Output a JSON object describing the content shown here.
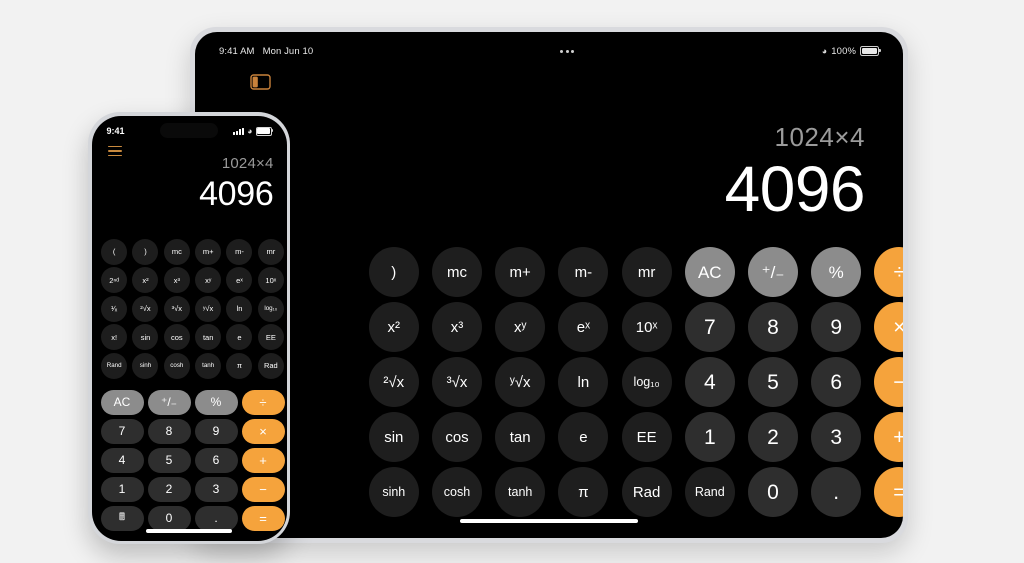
{
  "background_color": "#f2f2f2",
  "accent_color": "#f5a33c",
  "ipad": {
    "device_name": "iPad",
    "status_bar": {
      "time": "9:41 AM",
      "date": "Mon Jun 10",
      "multitask_icon": "ellipsis-icon",
      "wifi_icon": "wifi-icon",
      "battery_percent": "100%",
      "battery_icon": "battery-full-icon"
    },
    "sidebar_toggle_icon": "sidebar-toggle-icon",
    "display": {
      "expression": "1024×4",
      "result": "4096"
    },
    "home_indicator": "home-indicator",
    "keypad": {
      "columns": 10,
      "rows": [
        [
          {
            "label": ")",
            "style": "fn",
            "name": "close-paren"
          },
          {
            "label": "mc",
            "style": "fn",
            "name": "memory-clear"
          },
          {
            "label": "m+",
            "style": "fn",
            "name": "memory-add"
          },
          {
            "label": "m-",
            "style": "fn",
            "name": "memory-subtract"
          },
          {
            "label": "mr",
            "style": "fn",
            "name": "memory-recall"
          },
          {
            "label": "AC",
            "style": "light",
            "name": "all-clear"
          },
          {
            "label": "⁺/₋",
            "style": "light",
            "name": "plus-minus"
          },
          {
            "label": "%",
            "style": "light",
            "name": "percent"
          },
          {
            "label": "÷",
            "style": "accent",
            "name": "divide"
          }
        ],
        [
          {
            "label": "x²",
            "style": "fn",
            "name": "x-squared"
          },
          {
            "label": "x³",
            "style": "fn",
            "name": "x-cubed"
          },
          {
            "label": "xʸ",
            "style": "fn",
            "name": "x-power-y"
          },
          {
            "label": "eˣ",
            "style": "fn",
            "name": "e-power-x"
          },
          {
            "label": "10ˣ",
            "style": "fn",
            "name": "ten-power-x"
          },
          {
            "label": "7",
            "style": "num",
            "name": "digit-7"
          },
          {
            "label": "8",
            "style": "num",
            "name": "digit-8"
          },
          {
            "label": "9",
            "style": "num",
            "name": "digit-9"
          },
          {
            "label": "×",
            "style": "accent",
            "name": "multiply"
          }
        ],
        [
          {
            "label": "²√x",
            "style": "fn",
            "name": "square-root"
          },
          {
            "label": "³√x",
            "style": "fn",
            "name": "cube-root"
          },
          {
            "label": "ʸ√x",
            "style": "fn",
            "name": "y-root"
          },
          {
            "label": "ln",
            "style": "fn",
            "name": "natural-log"
          },
          {
            "label": "log₁₀",
            "style": "fn",
            "name": "log-base-10"
          },
          {
            "label": "4",
            "style": "num",
            "name": "digit-4"
          },
          {
            "label": "5",
            "style": "num",
            "name": "digit-5"
          },
          {
            "label": "6",
            "style": "num",
            "name": "digit-6"
          },
          {
            "label": "−",
            "style": "accent",
            "name": "subtract"
          }
        ],
        [
          {
            "label": "sin",
            "style": "fn",
            "name": "sine"
          },
          {
            "label": "cos",
            "style": "fn",
            "name": "cosine"
          },
          {
            "label": "tan",
            "style": "fn",
            "name": "tangent"
          },
          {
            "label": "e",
            "style": "fn",
            "name": "euler-number"
          },
          {
            "label": "EE",
            "style": "fn",
            "name": "exponent-entry"
          },
          {
            "label": "1",
            "style": "num",
            "name": "digit-1"
          },
          {
            "label": "2",
            "style": "num",
            "name": "digit-2"
          },
          {
            "label": "3",
            "style": "num",
            "name": "digit-3"
          },
          {
            "label": "+",
            "style": "accent",
            "name": "add"
          }
        ],
        [
          {
            "label": "sinh",
            "style": "fn",
            "name": "hyperbolic-sine"
          },
          {
            "label": "cosh",
            "style": "fn",
            "name": "hyperbolic-cosine"
          },
          {
            "label": "tanh",
            "style": "fn",
            "name": "hyperbolic-tangent"
          },
          {
            "label": "π",
            "style": "fn",
            "name": "pi"
          },
          {
            "label": "Rad",
            "style": "fn",
            "name": "radians-toggle"
          },
          {
            "label": "Rand",
            "style": "fn",
            "name": "random"
          },
          {
            "label": "0",
            "style": "num",
            "name": "digit-0"
          },
          {
            "label": ".",
            "style": "num",
            "name": "decimal-point"
          },
          {
            "label": "=",
            "style": "accent",
            "name": "equals"
          }
        ]
      ]
    }
  },
  "iphone": {
    "device_name": "iPhone",
    "status_bar": {
      "time": "9:41",
      "signal_icon": "cellular-signal-icon",
      "wifi_icon": "wifi-icon",
      "battery_icon": "battery-full-icon"
    },
    "menu_icon": "hamburger-menu-icon",
    "display": {
      "expression": "1024×4",
      "result": "4096"
    },
    "home_indicator": "home-indicator",
    "scientific_rows": [
      [
        {
          "label": "(",
          "name": "open-paren"
        },
        {
          "label": ")",
          "name": "close-paren"
        },
        {
          "label": "mc",
          "name": "memory-clear"
        },
        {
          "label": "m+",
          "name": "memory-add"
        },
        {
          "label": "m-",
          "name": "memory-subtract"
        },
        {
          "label": "mr",
          "name": "memory-recall"
        }
      ],
      [
        {
          "label": "2ⁿᵈ",
          "name": "second-function"
        },
        {
          "label": "x²",
          "name": "x-squared"
        },
        {
          "label": "x³",
          "name": "x-cubed"
        },
        {
          "label": "xʸ",
          "name": "x-power-y"
        },
        {
          "label": "eˣ",
          "name": "e-power-x"
        },
        {
          "label": "10ˣ",
          "name": "ten-power-x"
        }
      ],
      [
        {
          "label": "¹∕ₓ",
          "name": "reciprocal"
        },
        {
          "label": "²√x",
          "name": "square-root"
        },
        {
          "label": "³√x",
          "name": "cube-root"
        },
        {
          "label": "ʸ√x",
          "name": "y-root"
        },
        {
          "label": "ln",
          "name": "natural-log"
        },
        {
          "label": "log₁₀",
          "name": "log-base-10"
        }
      ],
      [
        {
          "label": "x!",
          "name": "factorial"
        },
        {
          "label": "sin",
          "name": "sine"
        },
        {
          "label": "cos",
          "name": "cosine"
        },
        {
          "label": "tan",
          "name": "tangent"
        },
        {
          "label": "e",
          "name": "euler-number"
        },
        {
          "label": "EE",
          "name": "exponent-entry"
        }
      ],
      [
        {
          "label": "Rand",
          "name": "random"
        },
        {
          "label": "sinh",
          "name": "hyperbolic-sine"
        },
        {
          "label": "cosh",
          "name": "hyperbolic-cosine"
        },
        {
          "label": "tanh",
          "name": "hyperbolic-tangent"
        },
        {
          "label": "π",
          "name": "pi"
        },
        {
          "label": "Rad",
          "name": "radians-toggle"
        }
      ]
    ],
    "keypad_rows": [
      [
        {
          "label": "AC",
          "style": "light",
          "name": "all-clear"
        },
        {
          "label": "⁺/₋",
          "style": "light",
          "name": "plus-minus"
        },
        {
          "label": "%",
          "style": "light",
          "name": "percent"
        },
        {
          "label": "÷",
          "style": "accent",
          "name": "divide"
        }
      ],
      [
        {
          "label": "7",
          "style": "num",
          "name": "digit-7"
        },
        {
          "label": "8",
          "style": "num",
          "name": "digit-8"
        },
        {
          "label": "9",
          "style": "num",
          "name": "digit-9"
        },
        {
          "label": "×",
          "style": "accent",
          "name": "multiply"
        }
      ],
      [
        {
          "label": "4",
          "style": "num",
          "name": "digit-4"
        },
        {
          "label": "5",
          "style": "num",
          "name": "digit-5"
        },
        {
          "label": "6",
          "style": "num",
          "name": "digit-6"
        },
        {
          "label": "+",
          "style": "accent",
          "name": "add"
        }
      ],
      [
        {
          "label": "1",
          "style": "num",
          "name": "digit-1"
        },
        {
          "label": "2",
          "style": "num",
          "name": "digit-2"
        },
        {
          "label": "3",
          "style": "num",
          "name": "digit-3"
        },
        {
          "label": "−",
          "style": "accent",
          "name": "subtract"
        }
      ],
      [
        {
          "label": "🖩",
          "style": "calcicon",
          "name": "calculator-mode-icon"
        },
        {
          "label": "0",
          "style": "num",
          "name": "digit-0"
        },
        {
          "label": ".",
          "style": "num",
          "name": "decimal-point"
        },
        {
          "label": "=",
          "style": "accent",
          "name": "equals"
        }
      ]
    ]
  }
}
